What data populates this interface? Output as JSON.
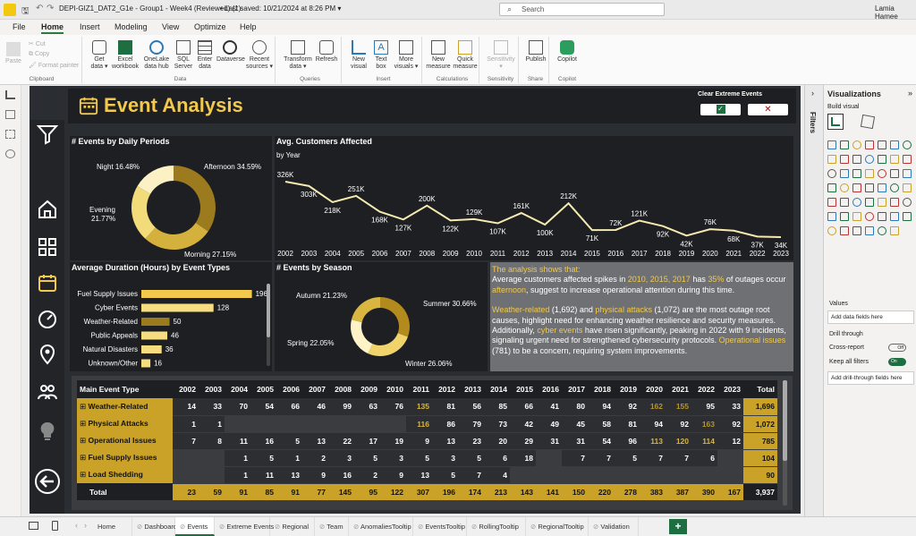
{
  "app": {
    "file_title": "DEPI-GIZ1_DAT2_G1e - Group1 - Week4 (Reviewed) (1)",
    "last_saved": "Last saved: 10/21/2024 at 8:26 PM",
    "search_placeholder": "Search",
    "user": "Lamia Hamee"
  },
  "menu": [
    "File",
    "Home",
    "Insert",
    "Modeling",
    "View",
    "Optimize",
    "Help"
  ],
  "ribbon": {
    "clipboard": {
      "paste": "Paste",
      "cut": "Cut",
      "copy": "Copy",
      "format_painter": "Format painter",
      "label": "Clipboard"
    },
    "data": {
      "items": [
        "Get data",
        "Excel workbook",
        "OneLake data hub",
        "SQL Server",
        "Enter data",
        "Dataverse",
        "Recent sources"
      ],
      "label": "Data"
    },
    "queries": {
      "items": [
        "Transform data",
        "Refresh"
      ],
      "label": "Queries"
    },
    "insert": {
      "items": [
        "New visual",
        "Text box",
        "More visuals"
      ],
      "label": "Insert"
    },
    "calculations": {
      "items": [
        "New measure",
        "Quick measure"
      ],
      "label": "Calculations"
    },
    "sensitivity": {
      "items": [
        "Sensitivity"
      ],
      "label": "Sensitivity"
    },
    "share": {
      "items": [
        "Publish"
      ],
      "label": "Share"
    },
    "copilot": {
      "items": [
        "Copilot"
      ],
      "label": "Copilot"
    }
  },
  "report": {
    "title": "Event Analysis",
    "clear_label": "Clear Extreme Events",
    "ok_glyph": "✓",
    "cancel_glyph": "✕"
  },
  "colors": {
    "gold": "#c9a227",
    "dark": "#1e1f22",
    "bg": "#2a2d31",
    "line": "#f5eab0"
  },
  "daily_periods": {
    "title": "# Events by Daily Periods",
    "labels": [
      "Night 16.48%",
      "Afternoon 34.59%",
      "Evening",
      "21.77%",
      "Morning 27.15%"
    ],
    "chart_data": {
      "type": "pie",
      "categories": [
        "Afternoon",
        "Morning",
        "Evening",
        "Night"
      ],
      "values": [
        34.59,
        27.15,
        21.77,
        16.48
      ]
    }
  },
  "customers": {
    "title": "Avg. Customers Affected",
    "subtitle": "by Year",
    "chart_data": {
      "type": "line",
      "x": [
        "2002",
        "2003",
        "2004",
        "2005",
        "2006",
        "2007",
        "2008",
        "2009",
        "2010",
        "2011",
        "2012",
        "2013",
        "2014",
        "2015",
        "2016",
        "2017",
        "2018",
        "2019",
        "2020",
        "2021",
        "2022",
        "2023"
      ],
      "labels": [
        "326K",
        "303K",
        "218K",
        "251K",
        "168K",
        "127K",
        "200K",
        "122K",
        "129K",
        "107K",
        "161K",
        "100K",
        "212K",
        "71K",
        "72K",
        "121K",
        "92K",
        "42K",
        "76K",
        "68K",
        "37K",
        "34K"
      ],
      "values": [
        326,
        303,
        218,
        251,
        168,
        127,
        200,
        122,
        129,
        107,
        161,
        100,
        212,
        71,
        72,
        121,
        92,
        42,
        76,
        68,
        37,
        34
      ]
    }
  },
  "duration": {
    "title": "Average Duration (Hours) by Event Types",
    "chart_data": {
      "type": "bar",
      "categories": [
        "Fuel Supply Issues",
        "Cyber Events",
        "Weather-Related",
        "Public Appeals",
        "Natural Disasters",
        "Unknown/Other"
      ],
      "values": [
        196,
        128,
        50,
        46,
        36,
        16
      ]
    }
  },
  "season": {
    "title": "# Events by Season",
    "labels": [
      "Autumn 21.23%",
      "Summer 30.66%",
      "Spring 22.05%",
      "Winter 26.06%"
    ],
    "chart_data": {
      "type": "pie",
      "categories": [
        "Summer",
        "Winter",
        "Spring",
        "Autumn"
      ],
      "values": [
        30.66,
        26.06,
        22.05,
        21.23
      ]
    }
  },
  "insight": {
    "p1": {
      "a": "The analysis shows that:",
      "b": "Average customers affected spikes in ",
      "y": "2010, 2015, 2017",
      "c": " has ",
      "p": "35%",
      "d": " of outages occur ",
      "e": "afternoon",
      "f": ", suggest to increase operational attention during this time."
    },
    "p2": {
      "a": "Weather-related",
      "b": " (1,692) and ",
      "c": "physical attacks",
      "d": " (1,072) are the most outage root causes, highlight need for enhancing weather resilience and security measures. Additionally, ",
      "e": "cyber events",
      "f": " have risen significantly, peaking in 2022 with 9 incidents, signaling urgent need for strengthened cybersecurity protocols. ",
      "g": "Operational issues",
      "h": " (781) to be a concern, requiring system improvements."
    }
  },
  "matrix": {
    "header": [
      "Main Event Type",
      "2002",
      "2003",
      "2004",
      "2005",
      "2006",
      "2007",
      "2008",
      "2009",
      "2010",
      "2011",
      "2012",
      "2013",
      "2014",
      "2015",
      "2016",
      "2017",
      "2018",
      "2019",
      "2020",
      "2021",
      "2022",
      "2023",
      "Total"
    ],
    "rows": [
      {
        "name": "Weather-Related",
        "cells": [
          "14",
          "33",
          "70",
          "54",
          "66",
          "46",
          "99",
          "63",
          "76",
          "135",
          "81",
          "56",
          "85",
          "66",
          "41",
          "80",
          "94",
          "92",
          "162",
          "155",
          "95",
          "33",
          "1,696"
        ]
      },
      {
        "name": "Physical Attacks",
        "cells": [
          "1",
          "1",
          "",
          "",
          "",
          "",
          "",
          "",
          "",
          "116",
          "86",
          "79",
          "73",
          "42",
          "49",
          "45",
          "58",
          "81",
          "94",
          "92",
          "163",
          "92",
          "1,072"
        ]
      },
      {
        "name": "Operational Issues",
        "cells": [
          "7",
          "8",
          "11",
          "16",
          "5",
          "13",
          "22",
          "17",
          "19",
          "9",
          "13",
          "23",
          "20",
          "29",
          "31",
          "31",
          "54",
          "96",
          "113",
          "120",
          "114",
          "12",
          "785"
        ]
      },
      {
        "name": "Fuel Supply Issues",
        "cells": [
          "",
          "",
          "1",
          "5",
          "1",
          "2",
          "3",
          "5",
          "3",
          "5",
          "3",
          "5",
          "6",
          "18",
          "",
          "7",
          "7",
          "5",
          "7",
          "7",
          "6",
          "",
          "104"
        ]
      },
      {
        "name": "Load Shedding",
        "cells": [
          "",
          "",
          "1",
          "11",
          "13",
          "9",
          "16",
          "2",
          "9",
          "13",
          "5",
          "7",
          "4",
          "",
          "",
          "",
          "",
          "",
          "",
          "",
          "",
          "",
          "90"
        ]
      }
    ],
    "total": {
      "name": "Total",
      "cells": [
        "23",
        "59",
        "91",
        "85",
        "91",
        "77",
        "145",
        "95",
        "122",
        "307",
        "196",
        "174",
        "213",
        "143",
        "141",
        "150",
        "220",
        "278",
        "383",
        "387",
        "390",
        "167",
        "3,937"
      ]
    }
  },
  "viz_pane": {
    "title": "Visualizations",
    "build": "Build visual",
    "values_label": "Values",
    "add_data": "Add data fields here",
    "drill": "Drill through",
    "cross": "Cross-report",
    "cross_state": "Off",
    "keep": "Keep all filters",
    "keep_state": "On",
    "add_drill": "Add drill-through fields here",
    "filters": "Filters"
  },
  "tabs": [
    "Home",
    "Dashboard",
    "Events",
    "Extreme Events",
    "Regional",
    "Team",
    "AnomaliesTooltip",
    "EventsTooltip",
    "RollingTooltip",
    "RegionalTooltip",
    "Validation"
  ],
  "tab_add": "+"
}
